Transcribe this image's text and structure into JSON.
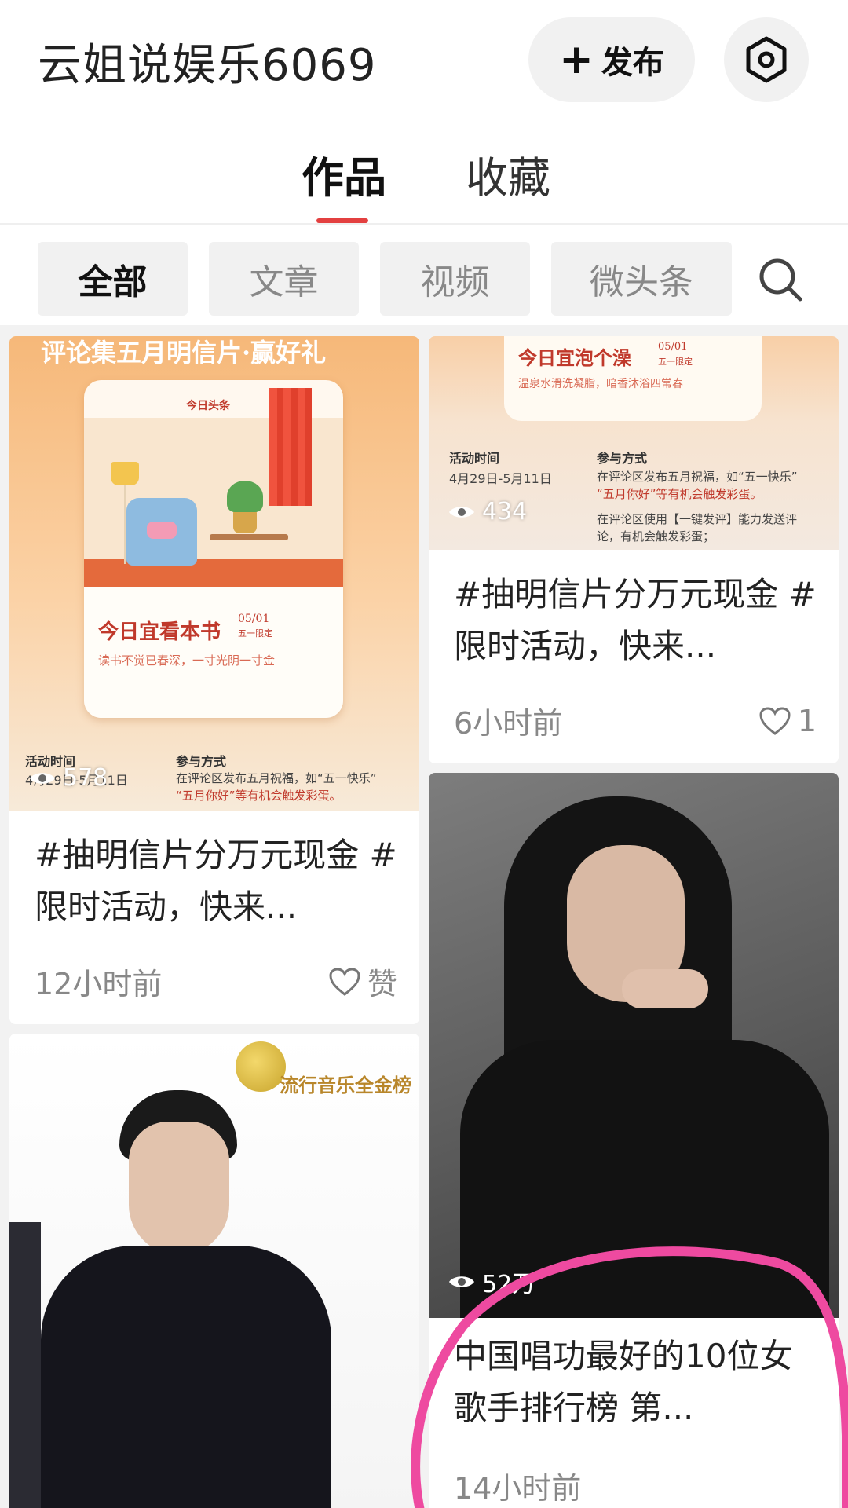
{
  "header": {
    "account_name": "云姐说娱乐6069",
    "publish_label": "发布",
    "publish_icon": "plus-icon",
    "settings_icon": "hexagon-settings-icon"
  },
  "tabs": [
    {
      "label": "作品",
      "active": true
    },
    {
      "label": "收藏",
      "active": false
    }
  ],
  "filters": [
    {
      "label": "全部",
      "active": true
    },
    {
      "label": "文章",
      "active": false
    },
    {
      "label": "视频",
      "active": false
    },
    {
      "label": "微头条",
      "active": false
    }
  ],
  "search_icon": "search-icon",
  "colors": {
    "accent": "#e34040",
    "highlight_circle": "#ee4aa0"
  },
  "cards": [
    {
      "views": "578",
      "title": "#抽明信片分万元现金 #限时活动，快来...",
      "time": "12小时前",
      "like_label": "赞",
      "poster": {
        "banner": "评论集五月明信片·赢好礼",
        "brand": "今日头条",
        "headline": "今日宜看本书",
        "date": "05/01",
        "note": "五一限定",
        "subline": "读书不觉已春深，一寸光阴一寸金",
        "activity_time_label": "活动时间",
        "activity_time": "4月29日-5月11日",
        "participate_label": "参与方式",
        "participate_text_1": "在评论区发布五月祝福，如“五一快乐”",
        "participate_text_2": "“五月你好”等有机会触发彩蛋。"
      }
    },
    {
      "views": "434",
      "title": "#抽明信片分万元现金 #限时活动，快来...",
      "time": "6小时前",
      "like_label": "1",
      "poster": {
        "headline": "今日宜泡个澡",
        "date": "05/01",
        "note": "五一限定",
        "subline": "温泉水滑洗凝脂，暗香沐浴四常春",
        "activity_time_label": "活动时间",
        "activity_time": "4月29日-5月11日",
        "participate_label": "参与方式",
        "participate_text_1": "在评论区发布五月祝福，如“五一快乐”",
        "participate_text_2": "“五月你好”等有机会触发彩蛋。",
        "participate_text_3": "在评论区使用【一键发评】能力发送评",
        "participate_text_4": "论，有机会触发彩蛋；"
      }
    },
    {
      "views": "52万",
      "title": "中国唱功最好的10位女歌手排行榜 第...",
      "time": "14小时前"
    },
    {
      "poster": {
        "brand": "流行音乐全金榜"
      }
    }
  ]
}
